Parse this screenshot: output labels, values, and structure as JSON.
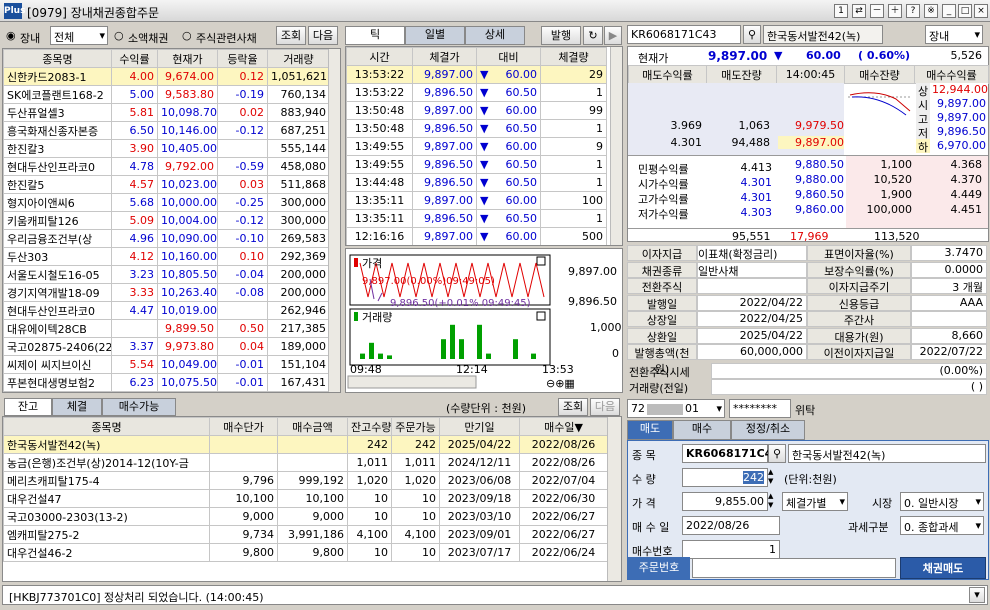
{
  "window": {
    "logo": "Plus",
    "title": "[0979] 장내채권종합주문",
    "page_num": "1",
    "icons": [
      "question-icon",
      "pin-icon",
      "minimize-icon",
      "maximize-icon",
      "close-icon"
    ]
  },
  "filter": {
    "radio1": "장내",
    "market": "전체",
    "radio2": "소액채권",
    "radio3": "주식관련사채",
    "query": "조회",
    "next": "다음"
  },
  "list": {
    "headers": [
      "종목명",
      "수익률",
      "현재가",
      "등락율",
      "거래량"
    ],
    "rows": [
      [
        "신한카드2083-1",
        "4.00",
        "9,674.00",
        "0.12",
        "1,051,621"
      ],
      [
        "SK에코플랜트168-2",
        "5.00",
        "9,583.80",
        "-0.19",
        "760,134"
      ],
      [
        "두산퓨얼셀3",
        "5.81",
        "10,098.70",
        "0.02",
        "883,940"
      ],
      [
        "흥국화재신종자본증",
        "6.50",
        "10,146.00",
        "-0.12",
        "687,251"
      ],
      [
        "한진칼3",
        "3.90",
        "10,405.00",
        "",
        "555,144"
      ],
      [
        "현대두산인프라코0",
        "4.78",
        "9,792.00",
        "-0.59",
        "458,080"
      ],
      [
        "한진칼5",
        "4.57",
        "10,023.00",
        "0.03",
        "511,868"
      ],
      [
        "형지아이앤씨6",
        "5.68",
        "10,000.00",
        "-0.25",
        "300,000"
      ],
      [
        "키움캐피탈126",
        "5.09",
        "10,004.00",
        "-0.12",
        "300,000"
      ],
      [
        "우리금융조건부(상",
        "4.96",
        "10,090.00",
        "-0.10",
        "269,583"
      ],
      [
        "두산303",
        "4.12",
        "10,160.00",
        "0.10",
        "292,369"
      ],
      [
        "서울도시철도16-05",
        "3.23",
        "10,805.50",
        "-0.04",
        "200,000"
      ],
      [
        "경기지역개발18-09",
        "3.33",
        "10,263.40",
        "-0.08",
        "200,000"
      ],
      [
        "현대두산인프라코0",
        "4.47",
        "10,019.00",
        "",
        "262,946"
      ],
      [
        "대유에이텍28CB",
        "",
        "9,899.50",
        "0.50",
        "217,385"
      ],
      [
        "국고02875-2406(22",
        "3.37",
        "9,973.80",
        "0.04",
        "189,000"
      ],
      [
        "씨제이 씨지브이신",
        "5.54",
        "10,049.00",
        "-0.01",
        "151,104"
      ],
      [
        "푸본현대생명보험2",
        "6.23",
        "10,075.50",
        "-0.01",
        "167,431"
      ]
    ]
  },
  "ticks": {
    "tabs": [
      "틱",
      "일별",
      "상세"
    ],
    "issue": "발행",
    "headers": [
      "시간",
      "체결가",
      "대비",
      "체결량"
    ],
    "rows": [
      [
        "13:53:22",
        "9,897.00",
        "60.00",
        "29"
      ],
      [
        "13:53:22",
        "9,896.50",
        "60.50",
        "1"
      ],
      [
        "13:50:48",
        "9,897.00",
        "60.00",
        "99"
      ],
      [
        "13:50:48",
        "9,896.50",
        "60.50",
        "1"
      ],
      [
        "13:49:55",
        "9,897.00",
        "60.00",
        "9"
      ],
      [
        "13:49:55",
        "9,896.50",
        "60.50",
        "1"
      ],
      [
        "13:44:48",
        "9,896.50",
        "60.50",
        "1"
      ],
      [
        "13:35:11",
        "9,897.00",
        "60.00",
        "100"
      ],
      [
        "13:35:11",
        "9,896.50",
        "60.50",
        "1"
      ],
      [
        "12:16:16",
        "9,897.00",
        "60.00",
        "500"
      ]
    ]
  },
  "mini_chart": {
    "price_label": "가격",
    "volume_label": "거래량",
    "max_note": "9,897.00(0.00%)09:49:05)",
    "min_note": "9,896.50(+0.01% 09:49:45)",
    "y_top": "9,897.00",
    "y_mid": "9,896.50",
    "vol_top": "1,000",
    "vol_zero": "0",
    "x_labels": [
      "09:48",
      "12:14",
      "13:53"
    ],
    "volumes": [
      0.15,
      0.45,
      0.15,
      0.1,
      0,
      0,
      0,
      0,
      0,
      0.55,
      0.95,
      0.55,
      0,
      0.95,
      0.15,
      0,
      0,
      0.55,
      0,
      0.15
    ]
  },
  "quote": {
    "code": "KR6068171C43",
    "name": "한국동서발전42(녹)",
    "market": "장내",
    "cur_label": "현재가",
    "cur_price": "9,897.00",
    "change": "60.00",
    "pct": "0.60%",
    "volume": "5,526",
    "headers": [
      "매도수익률",
      "매도잔량",
      "14:00:45",
      "매수잔량",
      "매수수익률"
    ],
    "ask": [
      [
        "3.969",
        "1,063",
        "9,979.50"
      ],
      [
        "4.301",
        "94,488",
        "9,897.00"
      ]
    ],
    "bid": [
      [
        "9,880.50",
        "1,100",
        "4.368"
      ],
      [
        "9,880.00",
        "10,520",
        "4.370"
      ],
      [
        "9,860.50",
        "1,900",
        "4.449"
      ],
      [
        "9,860.00",
        "100,000",
        "4.451"
      ]
    ],
    "side": [
      [
        "상",
        "12,944.00"
      ],
      [
        "시",
        "9,897.00"
      ],
      [
        "고",
        "9,897.00"
      ],
      [
        "저",
        "9,896.50"
      ],
      [
        "하",
        "6,970.00"
      ]
    ],
    "yields": [
      [
        "민평수익률",
        "4.413"
      ],
      [
        "시가수익률",
        "4.301"
      ],
      [
        "고가수익률",
        "4.301"
      ],
      [
        "저가수익률",
        "4.303"
      ]
    ],
    "total_ask": "95,551",
    "total_diff": "17,969",
    "total_bid": "113,520"
  },
  "info": [
    [
      "이자지급",
      "이표채(확정금리)",
      "표면이자율(%)",
      "3.7470"
    ],
    [
      "채권종류",
      "일반사채",
      "보장수익률(%)",
      "0.0000"
    ],
    [
      "전환주식",
      "",
      "이자지급주기",
      "3 개월"
    ],
    [
      "발행일",
      "2022/04/22",
      "신용등급",
      "AAA"
    ],
    [
      "상장일",
      "2022/04/25",
      "주간사",
      ""
    ],
    [
      "상환일",
      "2025/04/22",
      "대용가(원)",
      "8,660"
    ],
    [
      "발행총액(천원)",
      "60,000,000",
      "이전이자지급일",
      "2022/07/22"
    ]
  ],
  "conv": [
    [
      "전환주식시세",
      "(0.00%)"
    ],
    [
      "거래량(전일)",
      "( )"
    ]
  ],
  "bottom": {
    "tabs": [
      "잔고",
      "체결",
      "매수가능"
    ],
    "unit": "(수량단위 : 천원)",
    "query": "조회",
    "next": "다음",
    "headers": [
      "종목명",
      "매수단가",
      "매수금액",
      "잔고수량",
      "주문가능",
      "만기일",
      "매수일▼"
    ],
    "rows": [
      [
        "한국동서발전42(녹)",
        "",
        "",
        "242",
        "242",
        "2025/04/22",
        "2022/08/26"
      ],
      [
        "농금(은행)조건부(상)2014-12(10Y-금",
        "",
        "",
        "1,011",
        "1,011",
        "2024/12/11",
        "2022/08/26"
      ],
      [
        "메리츠캐피탈175-4",
        "9,796",
        "999,192",
        "1,020",
        "1,020",
        "2023/06/08",
        "2022/07/04"
      ],
      [
        "대우건설47",
        "10,100",
        "10,100",
        "10",
        "10",
        "2023/09/18",
        "2022/06/30"
      ],
      [
        "국고03000-2303(13-2)",
        "9,000",
        "9,000",
        "10",
        "10",
        "2023/03/10",
        "2022/06/27"
      ],
      [
        "엠캐피탈275-2",
        "9,734",
        "3,991,186",
        "4,100",
        "4,100",
        "2023/09/01",
        "2022/06/27"
      ],
      [
        "대우건설46-2",
        "9,800",
        "9,800",
        "10",
        "10",
        "2023/07/17",
        "2022/06/24"
      ]
    ]
  },
  "order": {
    "account": "72",
    "account_tail": "01",
    "password": "********",
    "trust": "위탁",
    "tabs": [
      "매도",
      "매수",
      "정정/취소"
    ],
    "code_label": "종 목",
    "code": "KR6068171C43",
    "name": "한국동서발전42(녹)",
    "qty_label": "수 량",
    "qty": "242",
    "qty_unit": "(단위:천원)",
    "price_label": "가 격",
    "price": "9,855.00",
    "price_type": "체결가별",
    "market_label": "시장",
    "market": "0. 일반시장",
    "date_label": "매 수 일",
    "date": "2022/08/26",
    "tax_label": "과세구분",
    "tax": "0. 종합과세",
    "seq_label": "매수번호",
    "seq": "1",
    "ordno_label": "주문번호",
    "submit": "채권매도"
  },
  "status": "[HKBJ773701C0] 정상처리 되었습니다. (14:00:45)"
}
